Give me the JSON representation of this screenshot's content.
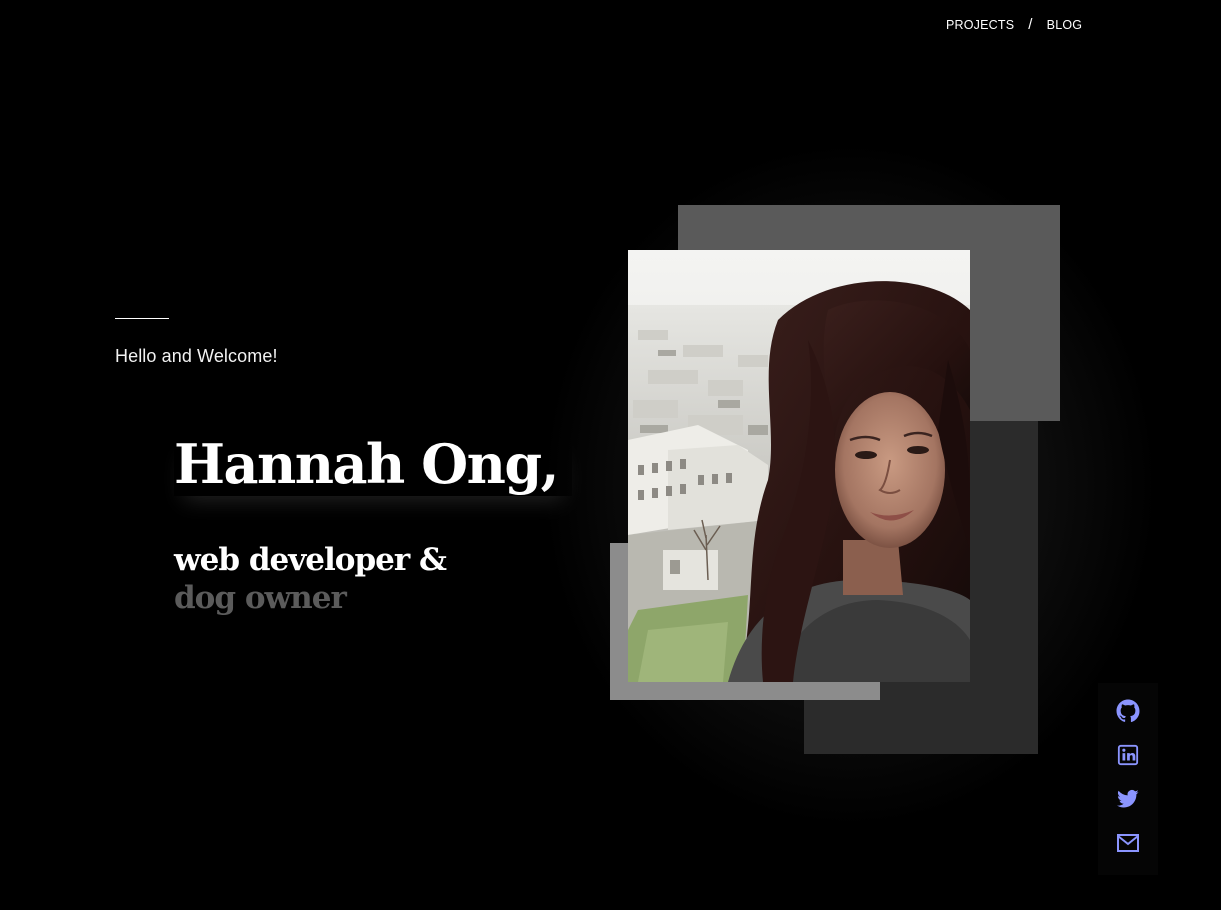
{
  "nav": {
    "projects_label": "PROJECTS",
    "separator": "/",
    "blog_label": "BLOG"
  },
  "intro": {
    "greeting": "Hello and Welcome!",
    "name": "Hannah Ong,",
    "role_line_1": "web developer &",
    "role_line_2": "dog owner"
  },
  "photo": {
    "alt": "Portrait of Hannah Ong overlooking a city"
  },
  "social": {
    "accent_color": "#8b95ff",
    "icons": [
      "github-icon",
      "linkedin-icon",
      "twitter-icon",
      "mail-icon"
    ]
  },
  "colors": {
    "background": "#000000",
    "text": "#ffffff",
    "muted_text": "#5b5b5b"
  }
}
